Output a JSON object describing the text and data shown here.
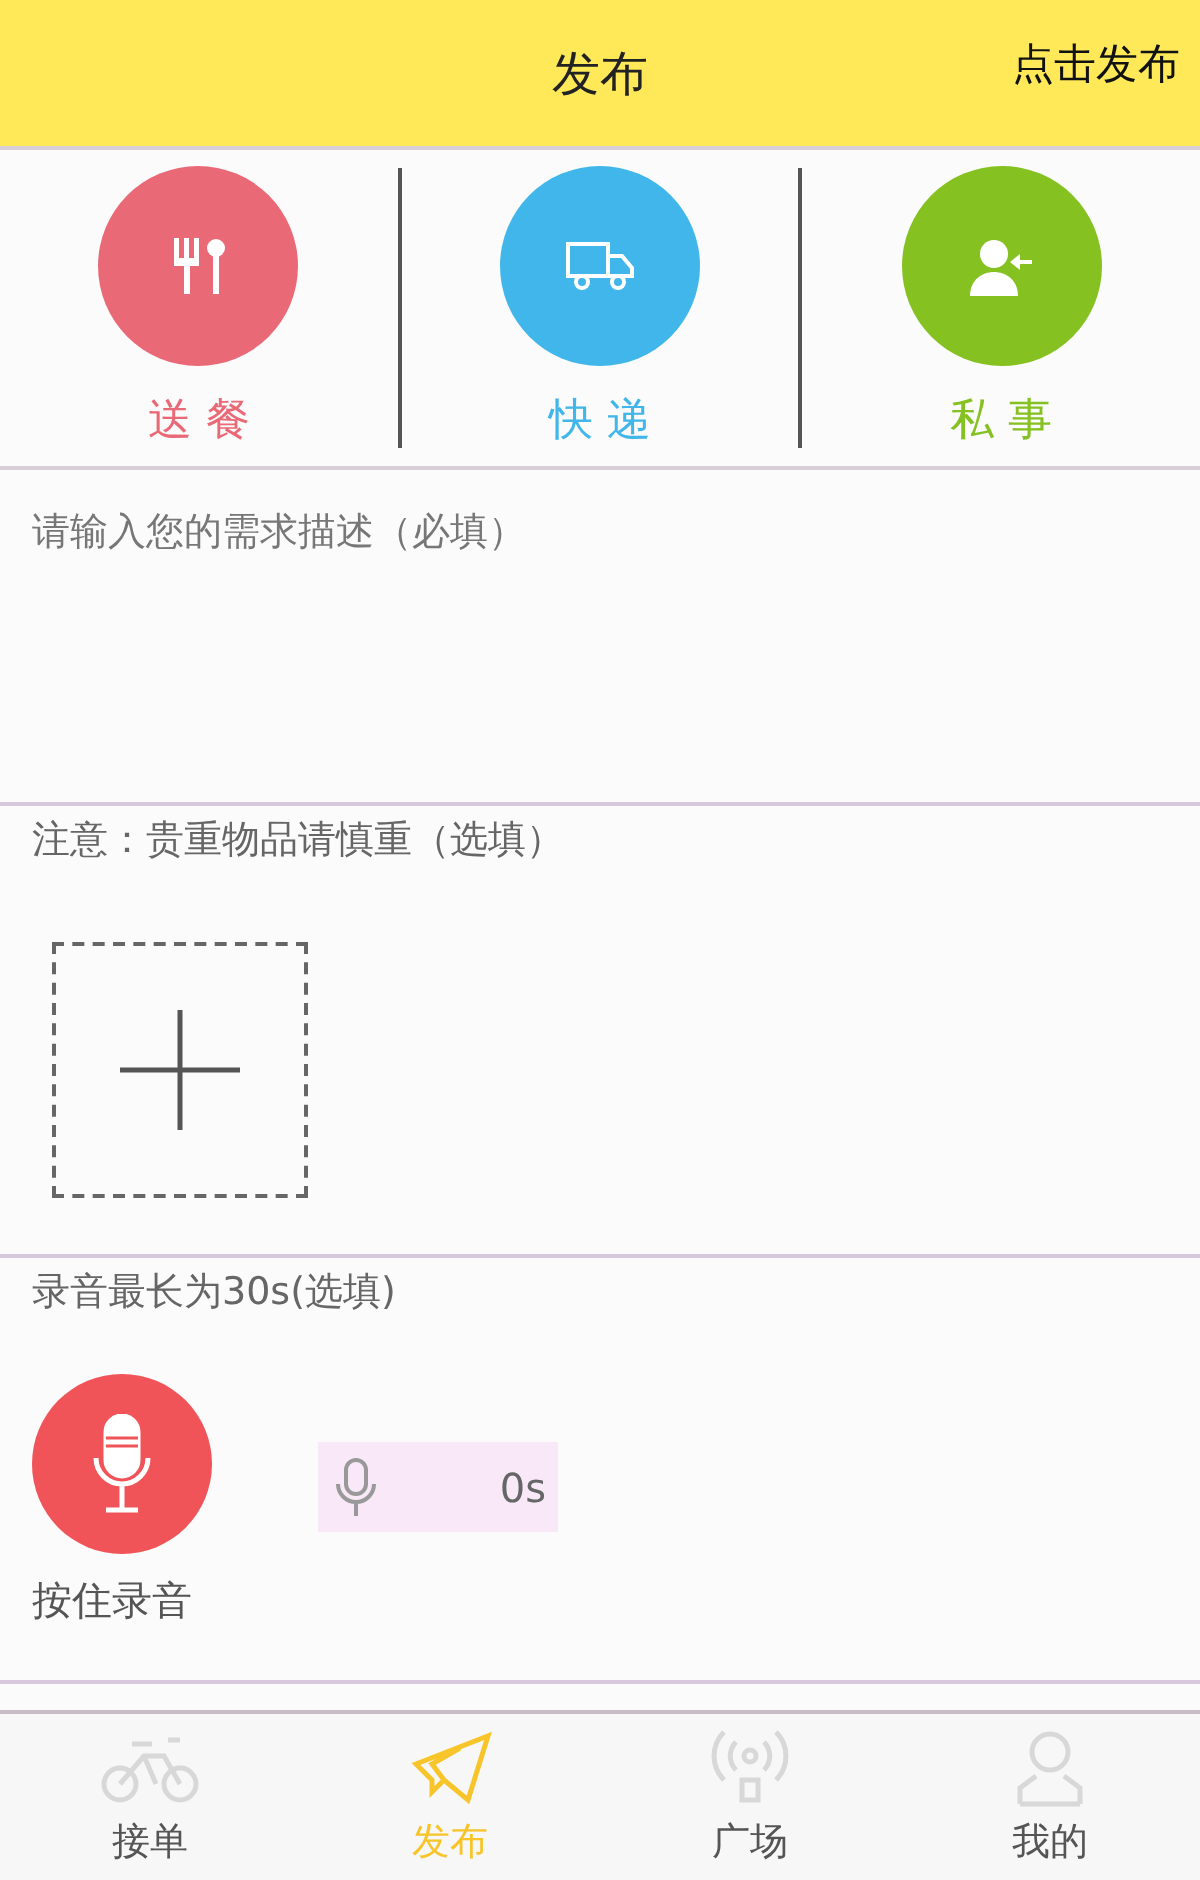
{
  "header": {
    "title": "发布",
    "action": "点击发布"
  },
  "categories": [
    {
      "kind": "food",
      "label": "送 餐",
      "color": "#e96976"
    },
    {
      "kind": "delivery",
      "label": "快 递",
      "color": "#41b6ea"
    },
    {
      "kind": "person",
      "label": "私 事",
      "color": "#86c122"
    }
  ],
  "description": {
    "placeholder": "请输入您的需求描述（必填）"
  },
  "note": {
    "label": "注意：贵重物品请慎重（选填）"
  },
  "recording": {
    "label": "录音最长为30s(选填)",
    "button_label": "按住录音",
    "duration": "0s"
  },
  "tabs": [
    {
      "kind": "bike",
      "label": "接单",
      "selected": false
    },
    {
      "kind": "send",
      "label": "发布",
      "selected": true
    },
    {
      "kind": "broadcast",
      "label": "广场",
      "selected": false
    },
    {
      "kind": "user",
      "label": "我的",
      "selected": false
    }
  ]
}
